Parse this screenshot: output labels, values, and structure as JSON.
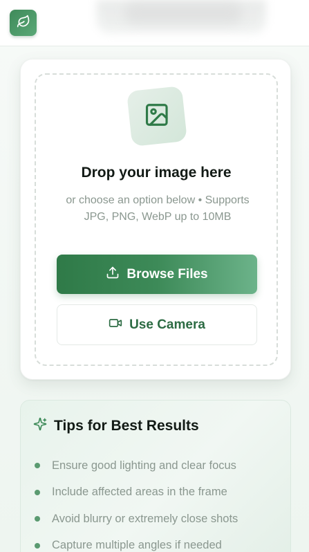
{
  "app": {
    "logo_icon": "leaf-icon",
    "accent": "#2f7a48"
  },
  "upload": {
    "icon": "image-icon",
    "title": "Drop your image here",
    "subtitle": "or choose an option below • Supports JPG, PNG, WebP up to 10MB",
    "browse_label": "Browse Files",
    "browse_icon": "upload-icon",
    "camera_label": "Use Camera",
    "camera_icon": "video-camera-icon"
  },
  "tips": {
    "icon": "sparkles-icon",
    "title": "Tips for Best Results",
    "items": [
      "Ensure good lighting and clear focus",
      "Include affected areas in the frame",
      "Avoid blurry or extremely close shots",
      "Capture multiple angles if needed"
    ]
  }
}
